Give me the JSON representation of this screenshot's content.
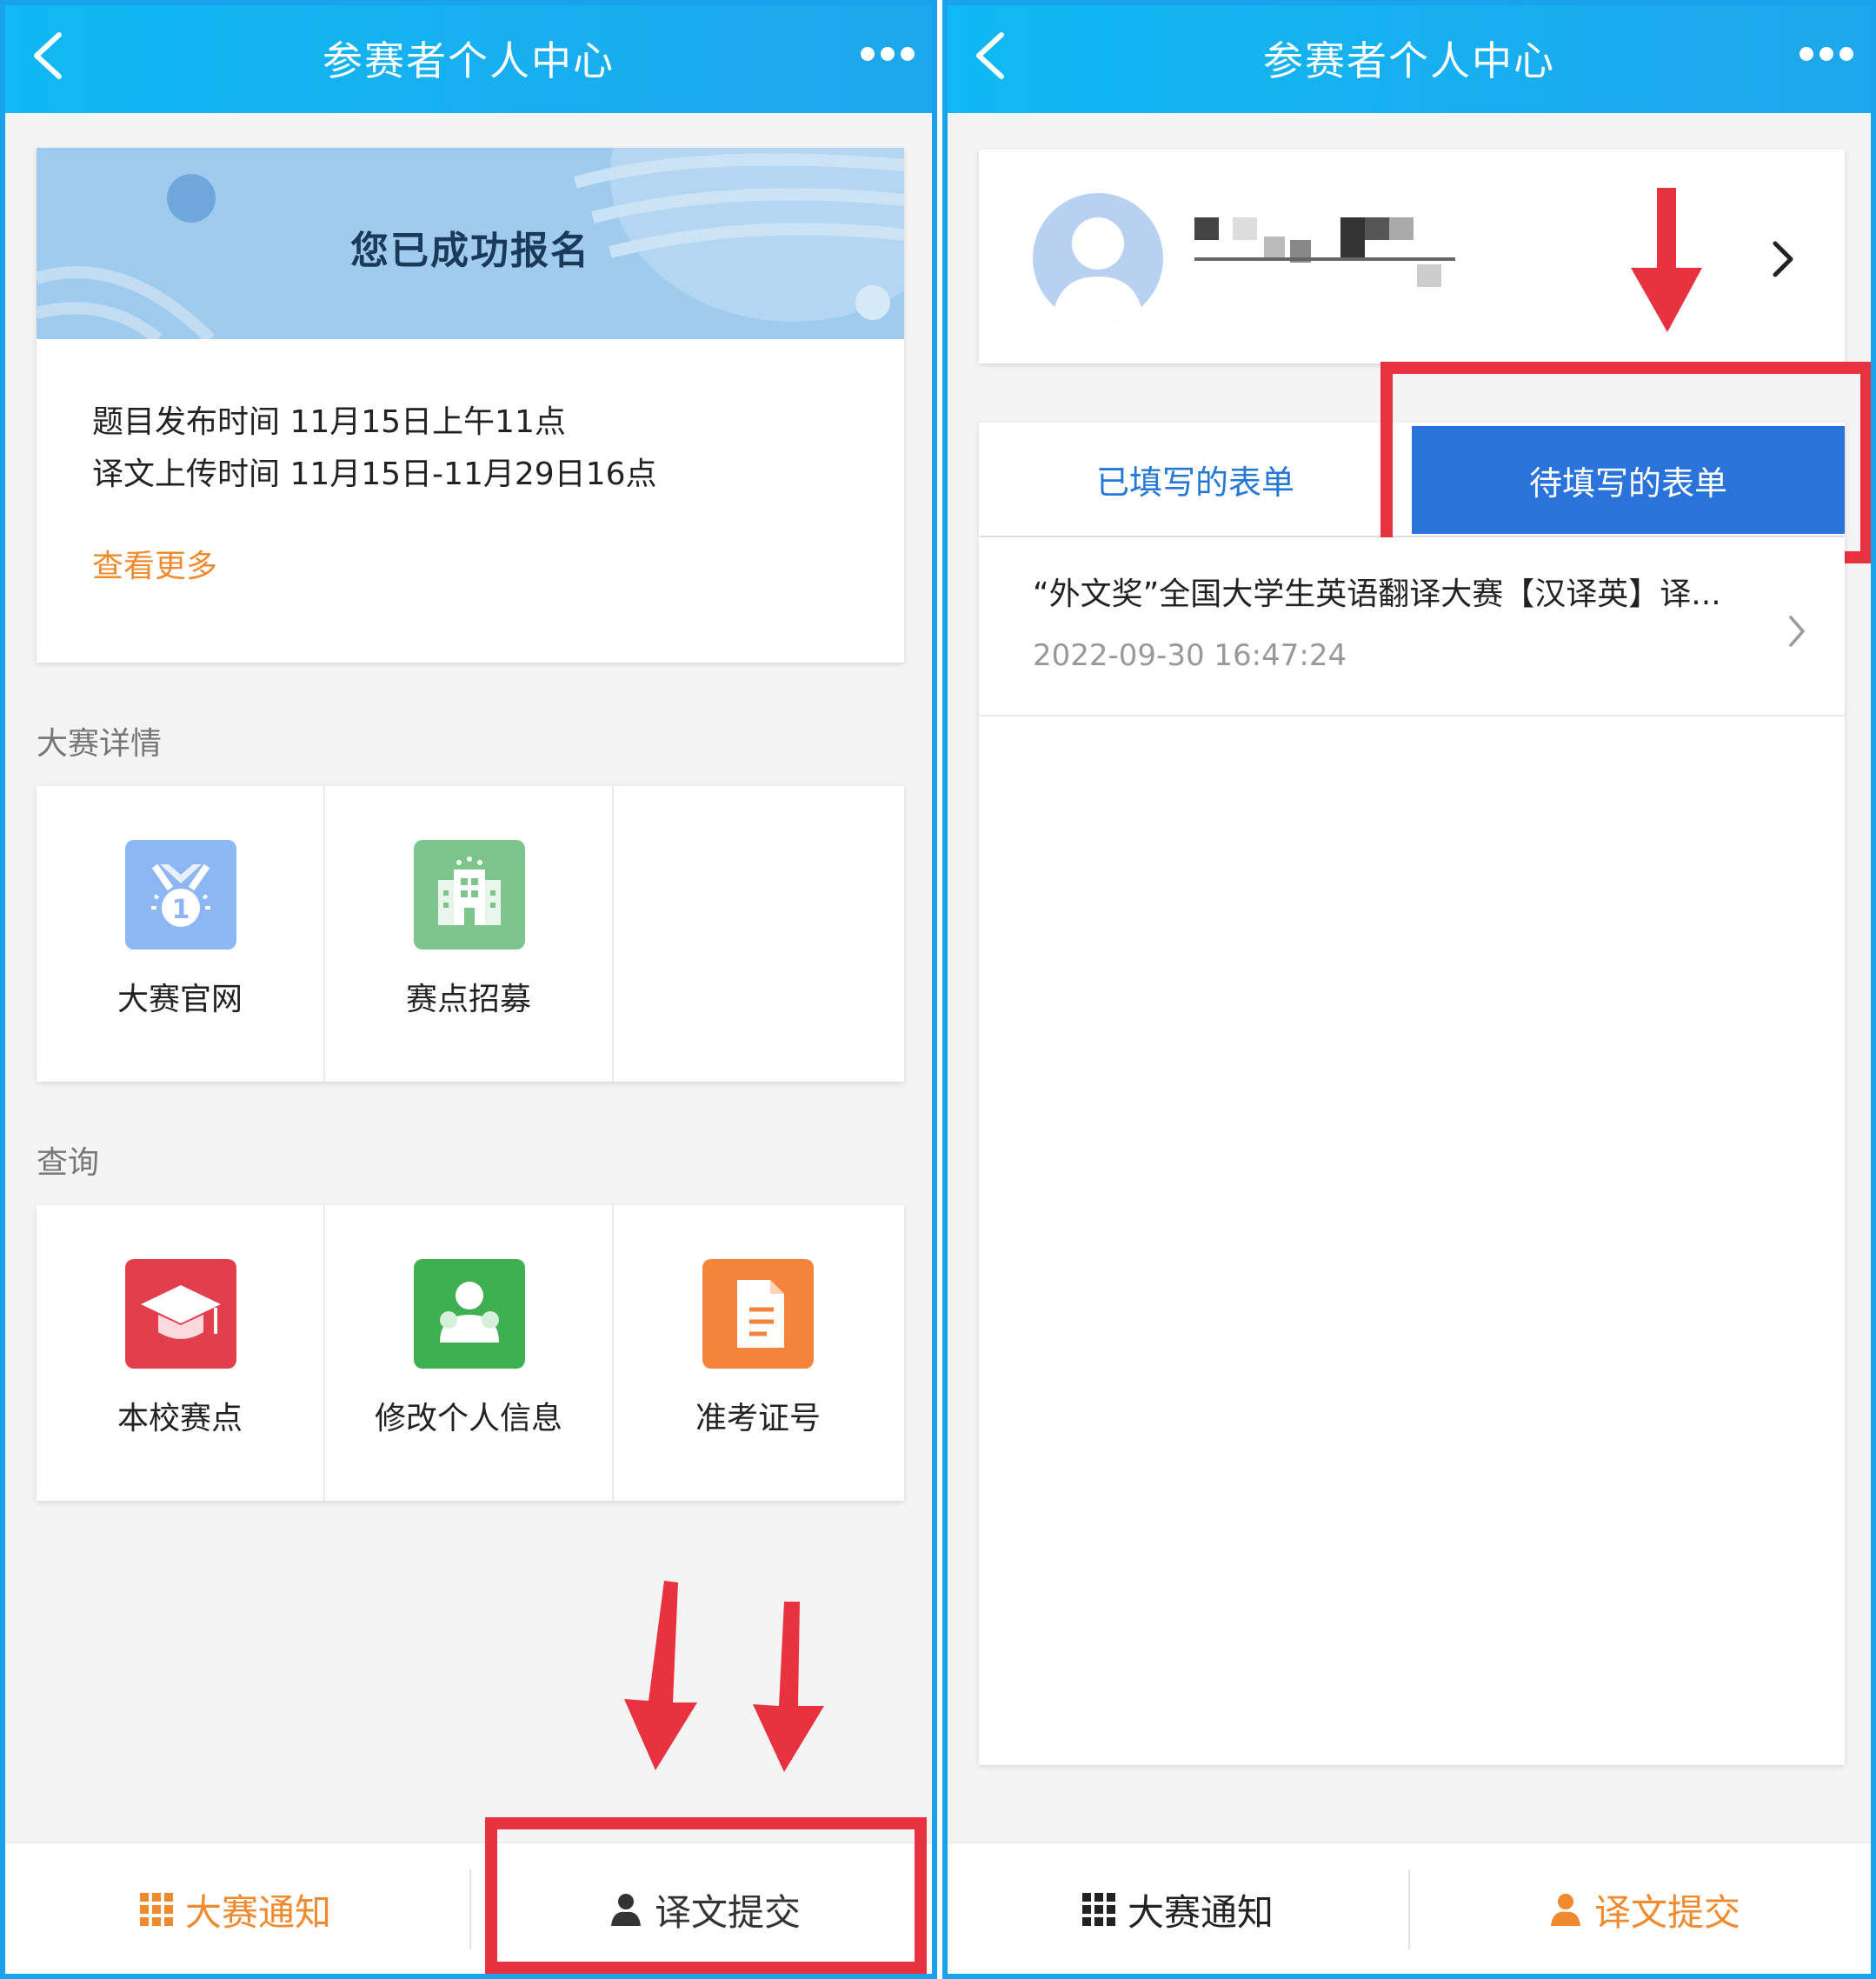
{
  "left": {
    "nav_title": "参赛者个人中心",
    "banner_title": "您已成功报名",
    "info_lines": [
      "题目发布时间 11月15日上午11点",
      "译文上传时间 11月15日-11月29日16点"
    ],
    "see_more": "查看更多",
    "section1_title": "大赛详情",
    "section1_items": [
      {
        "label": "大赛官网",
        "icon": "medal-icon",
        "color": "#8db6f4"
      },
      {
        "label": "赛点招募",
        "icon": "building-icon",
        "color": "#7dc58d"
      }
    ],
    "section2_title": "查询",
    "section2_items": [
      {
        "label": "本校赛点",
        "icon": "graduation-cap-icon",
        "color": "#e33e4b"
      },
      {
        "label": "修改个人信息",
        "icon": "person-icon",
        "color": "#3fb052"
      },
      {
        "label": "准考证号",
        "icon": "document-icon",
        "color": "#f4843a"
      }
    ],
    "tab_notice": "大赛通知",
    "tab_submit": "译文提交"
  },
  "right": {
    "nav_title": "参赛者个人中心",
    "tab_filled": "已填写的表单",
    "tab_pending": "待填写的表单",
    "form_item": {
      "title": "“外文奖”全国大学生英语翻译大赛【汉译英】译...",
      "time": "2022-09-30 16:47:24"
    },
    "tab_notice": "大赛通知",
    "tab_submit": "译文提交"
  },
  "colors": {
    "nav_blue": "#12b2f1",
    "accent_orange": "#ef8a2e",
    "highlight_red": "#e8323f",
    "active_tab_blue": "#2a73db"
  }
}
